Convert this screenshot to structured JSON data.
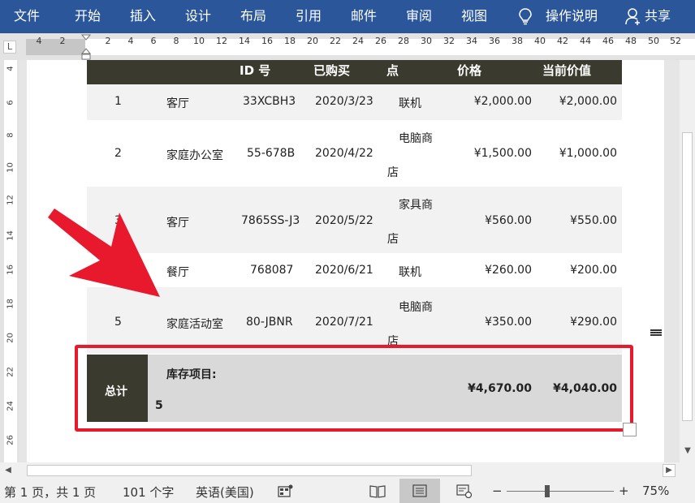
{
  "ribbon": {
    "tabs": [
      "文件",
      "开始",
      "插入",
      "设计",
      "布局",
      "引用",
      "邮件",
      "审阅",
      "视图"
    ],
    "tell_me": "操作说明",
    "share": "共享"
  },
  "ruler": {
    "numbers": [
      "4",
      "2",
      "2",
      "4",
      "6",
      "8",
      "10",
      "12",
      "14",
      "16",
      "18",
      "20",
      "22",
      "24",
      "26",
      "28",
      "30",
      "32",
      "34",
      "36",
      "38",
      "40",
      "42",
      "44",
      "46",
      "48",
      "50",
      "52"
    ]
  },
  "vruler": {
    "numbers": [
      "4",
      "6",
      "8",
      "10",
      "12",
      "14",
      "16",
      "18",
      "20",
      "22",
      "24",
      "26"
    ]
  },
  "table": {
    "headers": [
      "ID 号",
      "已购买",
      "点",
      "价格",
      "当前价值"
    ],
    "rows": [
      {
        "num": "1",
        "room": "客厅",
        "id": "33XCBH3",
        "date": "2020/3/23",
        "store1": "联机",
        "store2": "",
        "price": "¥2,000.00",
        "value": "¥2,000.00"
      },
      {
        "num": "2",
        "room": "家庭办公室",
        "id": "55-678B",
        "date": "2020/4/22",
        "store1": "电脑商",
        "store2": "店",
        "price": "¥1,500.00",
        "value": "¥1,000.00"
      },
      {
        "num": "3",
        "room": "客厅",
        "id": "7865SS-J3",
        "date": "2020/5/22",
        "store1": "家具商",
        "store2": "店",
        "price": "¥560.00",
        "value": "¥550.00"
      },
      {
        "num": "4",
        "room": "餐厅",
        "id": "768087",
        "date": "2020/6/21",
        "store1": "联机",
        "store2": "",
        "price": "¥260.00",
        "value": "¥200.00"
      },
      {
        "num": "5",
        "room": "家庭活动室",
        "id": "80-JBNR",
        "date": "2020/7/21",
        "store1": "电脑商",
        "store2": "店",
        "price": "¥350.00",
        "value": "¥290.00"
      }
    ],
    "total": {
      "label": "总计",
      "items_label": "库存项目:",
      "items_count": "5",
      "price": "¥4,670.00",
      "value": "¥4,040.00"
    }
  },
  "statusbar": {
    "page": "第 1 页，共 1 页",
    "words": "101 个字",
    "language": "英语(美国)",
    "zoom": "75%",
    "zoom_minus": "−",
    "zoom_plus": "+"
  },
  "colors": {
    "ribbon": "#2b579a",
    "table_header": "#3b3a2e",
    "row_alt": "#f2f2f2",
    "total_row": "#d9d9d9",
    "highlight": "#e8192c"
  }
}
